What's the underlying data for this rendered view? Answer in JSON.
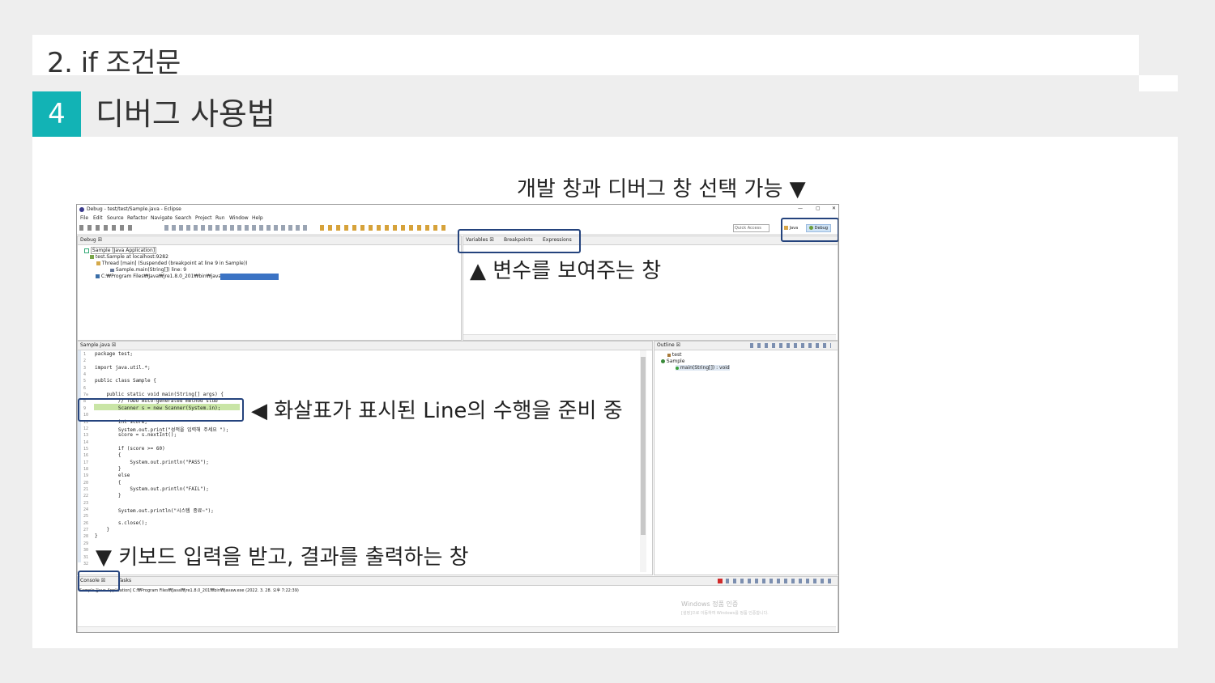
{
  "slide": {
    "title": "2. if 조건문",
    "section_number": "4",
    "section_title": "디버그 사용법"
  },
  "annotations": {
    "perspective": "개발 창과 디버그 창 선택 가능 ▼",
    "variables": "▲ 변수를 보여주는 창",
    "current_line": "◀ 화살표가 표시된 Line의 수행을 준비 중",
    "console": "▼ 키보드 입력을 받고, 결과를 출력하는 창"
  },
  "eclipse": {
    "window_title": "Debug - test/test/Sample.java - Eclipse",
    "window_controls": [
      "—",
      "▢",
      "✕"
    ],
    "menu": [
      "File",
      "Edit",
      "Source",
      "Refactor",
      "Navigate",
      "Search",
      "Project",
      "Run",
      "Window",
      "Help"
    ],
    "quick_access": "Quick Access",
    "perspectives": [
      "Java",
      "Debug"
    ],
    "debug_view": {
      "tab": "Debug ☒",
      "tree": [
        "Sample [Java Application]",
        "test.Sample at localhost:9282",
        "Thread [main] (Suspended (breakpoint at line 9 in Sample))",
        "Sample.main(String[]) line: 9",
        "C:₩Program Files₩Java₩jre1.8.0_201₩bin₩javaw.exe"
      ]
    },
    "variables_view": {
      "tabs": [
        "Variables ☒",
        "Breakpoints",
        "Expressions"
      ]
    },
    "editor": {
      "tab": "Sample.java ☒",
      "line_numbers": [
        "1",
        "2",
        "3",
        "4",
        "5",
        "6",
        "7⊖",
        "8",
        "9",
        "10",
        "11",
        "12",
        "13",
        "14",
        "15",
        "16",
        "17",
        "18",
        "19",
        "20",
        "21",
        "22",
        "23",
        "24",
        "25",
        "26",
        "27",
        "28",
        "29",
        "30",
        "31",
        "32"
      ],
      "lines": [
        "package test;",
        "",
        "import java.util.*;",
        "",
        "public class Sample {",
        "",
        "    public static void main(String[] args) {",
        "        // TODO Auto-generated method stub",
        "        Scanner s = new Scanner(System.in);",
        "",
        "        int score;",
        "        System.out.print(\"성적을 입력해 주세요 \");",
        "        score = s.nextInt();",
        "",
        "        if (score >= 60)",
        "        {",
        "            System.out.println(\"PASS\");",
        "        }",
        "        else",
        "        {",
        "            System.out.println(\"FAIL\");",
        "        }",
        "",
        "        System.out.println(\"시스템 종료~\");",
        "",
        "        s.close();",
        "    }",
        "}",
        "",
        "",
        "",
        ""
      ]
    },
    "outline": {
      "tab": "Outline ☒",
      "items": [
        "test",
        "Sample",
        "main(String[]) : void"
      ]
    },
    "console": {
      "tabs": [
        "Console ☒",
        "Tasks"
      ],
      "status": "Sample [Java Application] C:₩Program Files₩Java₩jre1.8.0_201₩bin₩javaw.exe (2022. 3. 28. 오후 7:22:39)"
    },
    "watermark": {
      "line1": "Windows 정품 인증",
      "line2": "[설정]으로 이동하여 Windows를 정품 인증합니다."
    }
  },
  "colors": {
    "accent": "#12b3b5",
    "highlight_border": "#24437d",
    "current_line_bg": "#c9e5a6",
    "progress_bar": "#3b73c4"
  }
}
